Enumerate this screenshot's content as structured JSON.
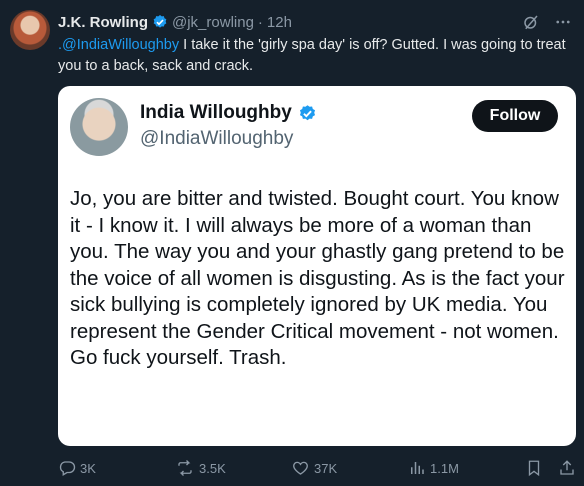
{
  "tweet": {
    "author_name": "J.K. Rowling",
    "handle": "@jk_rowling",
    "separator": "·",
    "time": "12h",
    "mention": ".@IndiaWilloughby",
    "text": " I take it the 'girly spa day' is off? Gutted. I was going to treat you to a back, sack and crack."
  },
  "quoted": {
    "author_name": "India Willoughby",
    "handle": "@IndiaWilloughby",
    "follow_label": "Follow",
    "text": "Jo, you are bitter and twisted. Bought court. You know it - I know it. I will always be more of a woman than you. The way you and your ghastly gang pretend to be the voice of all women is disgusting. As is the fact your sick bullying is completely ignored by UK media. You represent the Gender Critical movement - not women.  Go fuck yourself. Trash."
  },
  "actions": {
    "replies": "3K",
    "reposts": "3.5K",
    "likes": "37K",
    "views": "1.1M"
  },
  "colors": {
    "background": "#15202b",
    "accent": "#1d9bf0",
    "verified": "#1d9bf0"
  },
  "icons": [
    "grok-icon",
    "more-icon",
    "verified-icon",
    "reply-icon",
    "repost-icon",
    "like-icon",
    "views-icon",
    "bookmark-icon",
    "share-icon"
  ]
}
